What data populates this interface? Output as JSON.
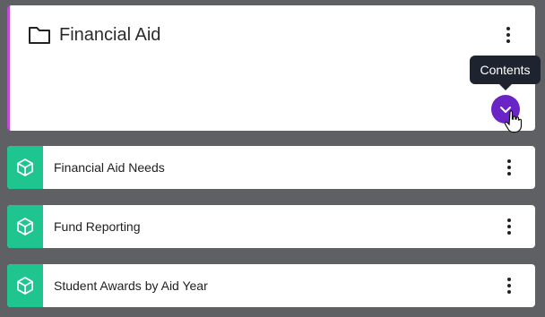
{
  "folder": {
    "title": "Financial Aid",
    "tooltip": "Contents",
    "accent": "#c14ad8",
    "button_color": "#6a25c7"
  },
  "items": [
    {
      "label": "Financial Aid Needs",
      "icon": "cube-icon"
    },
    {
      "label": "Fund Reporting",
      "icon": "cube-icon"
    },
    {
      "label": "Student Awards by Aid Year",
      "icon": "cube-icon"
    }
  ],
  "colors": {
    "item_icon_bg": "#1fc58e",
    "background": "#5f6063"
  }
}
